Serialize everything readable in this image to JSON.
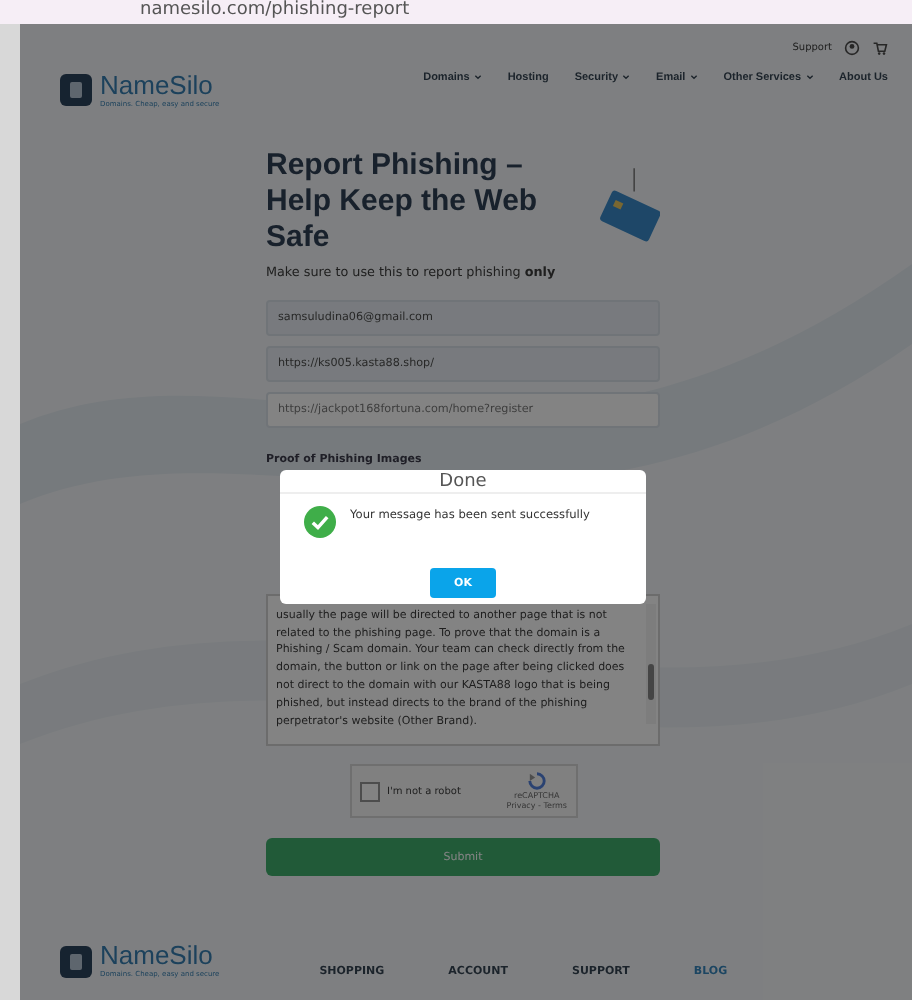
{
  "browser": {
    "url": "namesilo.com/phishing-report"
  },
  "header": {
    "logo": {
      "name_a": "Name",
      "name_b": "Silo",
      "tagline": "Domains. Cheap, easy and secure"
    },
    "support": "Support",
    "nav": [
      {
        "label": "Domains",
        "dropdown": true
      },
      {
        "label": "Hosting",
        "dropdown": false
      },
      {
        "label": "Security",
        "dropdown": true
      },
      {
        "label": "Email",
        "dropdown": true
      },
      {
        "label": "Other Services",
        "dropdown": true
      },
      {
        "label": "About Us",
        "dropdown": false
      }
    ]
  },
  "form": {
    "title": "Report Phishing – Help Keep the Web Safe",
    "subtitle": "Make sure to use this to report phishing **only**",
    "fields": [
      {
        "value": "samsuludina06@gmail.com"
      },
      {
        "value": "https://ks005.kasta88.shop/"
      },
      {
        "value": "https://jackpot168fortuna.com/home?register"
      }
    ],
    "proof_label": "Proof of Phishing Images",
    "message_lines": [
      "usually the page will be directed to another page that is not related to the phishing page. To prove that the domain is a Phishing / Scam domain. Your team can check directly from the domain, the button or link on the page after being clicked does not direct to the domain with our KASTA88 logo that is being phished, but instead directs to the brand of the phishing perpetrator's website (Other Brand)."
    ],
    "captcha": {
      "label": "I'm not a robot",
      "checked": false,
      "brand": "reCAPTCHA",
      "links": "Privacy - Terms"
    },
    "submit": "Submit"
  },
  "footer": {
    "logo": {
      "name_a": "Name",
      "name_b": "Silo",
      "tagline": "Domains. Cheap, easy and secure"
    },
    "links": [
      {
        "label": "SHOPPING",
        "selected": false
      },
      {
        "label": "ACCOUNT",
        "selected": false
      },
      {
        "label": "SUPPORT",
        "selected": false
      },
      {
        "label": "BLOG",
        "selected": true
      }
    ]
  },
  "dialog": {
    "title": "Done",
    "message": "Your message has been sent successfully",
    "button": "OK"
  }
}
